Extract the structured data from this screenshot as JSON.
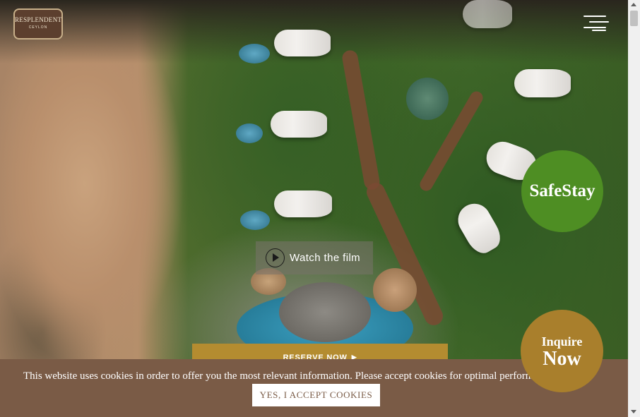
{
  "header": {
    "logo_text": "RESPLENDENT",
    "logo_subtext": "CEYLON",
    "menu_icon": "hamburger-menu-icon"
  },
  "hero": {
    "watch_film_label": "Watch the film",
    "play_icon": "play-circle-icon",
    "safestay_label": "SafeStay",
    "reserve_label": "RESERVE NOW",
    "reserve_icon": "caret-right-icon"
  },
  "inquire": {
    "line1": "Inquire",
    "line2": "Now"
  },
  "cookie_banner": {
    "text": "This website uses cookies in order to offer you the most relevant information. Please accept cookies for optimal performance.",
    "accept_label": "YES, I ACCEPT COOKIES"
  },
  "colors": {
    "safestay_green": "#4e8e23",
    "inquire_gold": "#a97f2c",
    "reserve_gold": "#b48c30",
    "cookie_brown": "#7a5b46"
  }
}
